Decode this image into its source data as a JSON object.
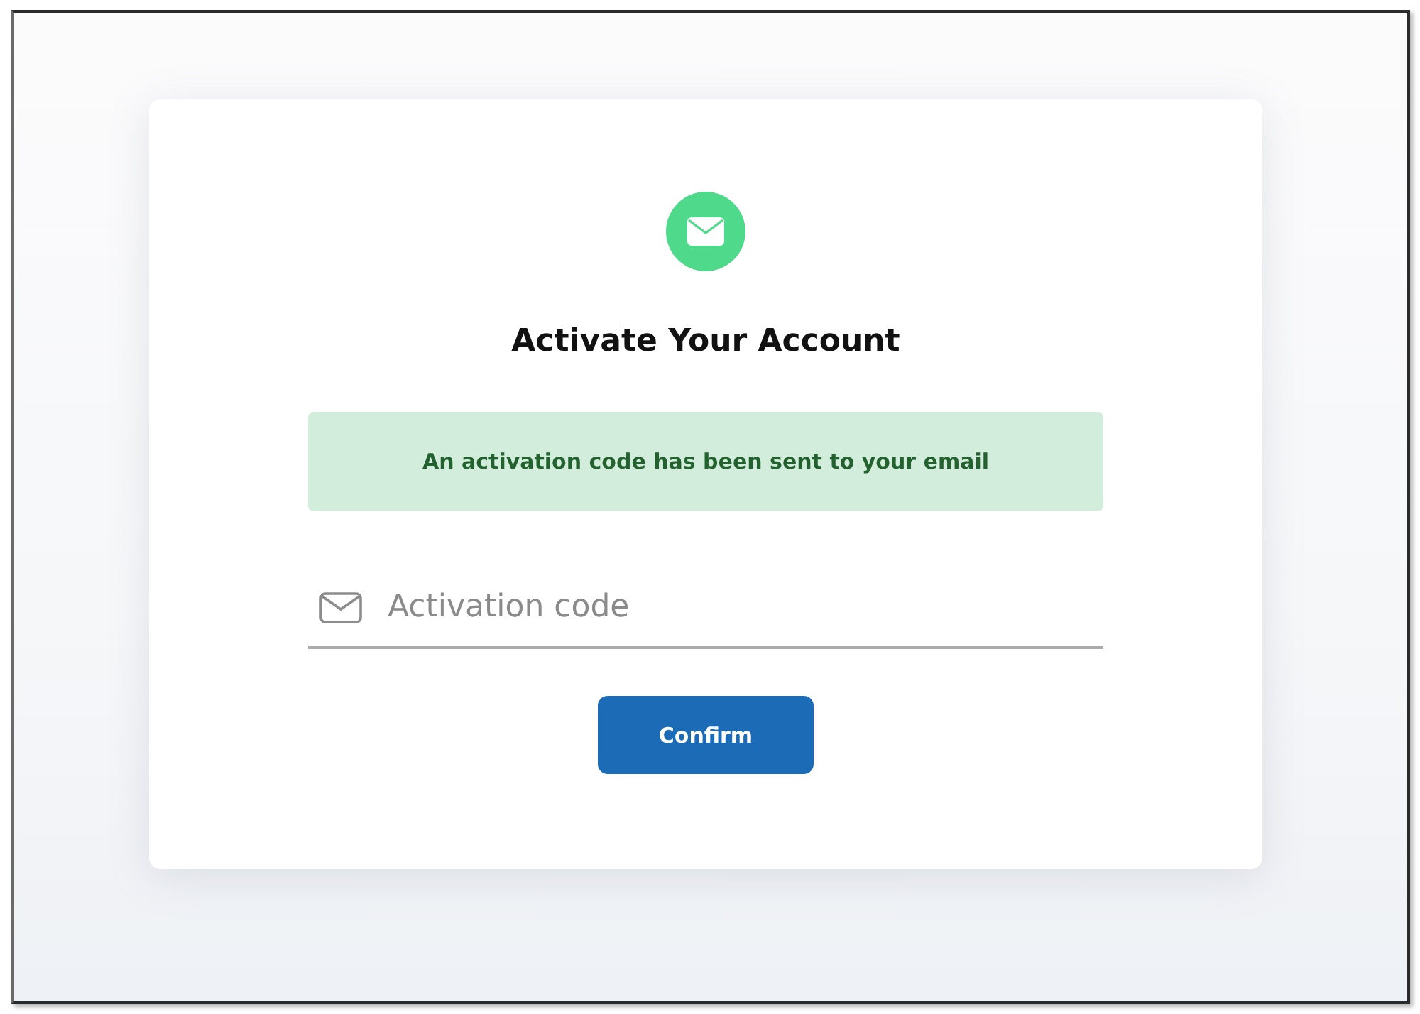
{
  "card": {
    "title": "Activate Your Account",
    "alert": {
      "message": "An activation code has been sent to your email"
    },
    "code_field": {
      "placeholder": "Activation code"
    },
    "confirm_button": {
      "label": "Confirm"
    }
  }
}
